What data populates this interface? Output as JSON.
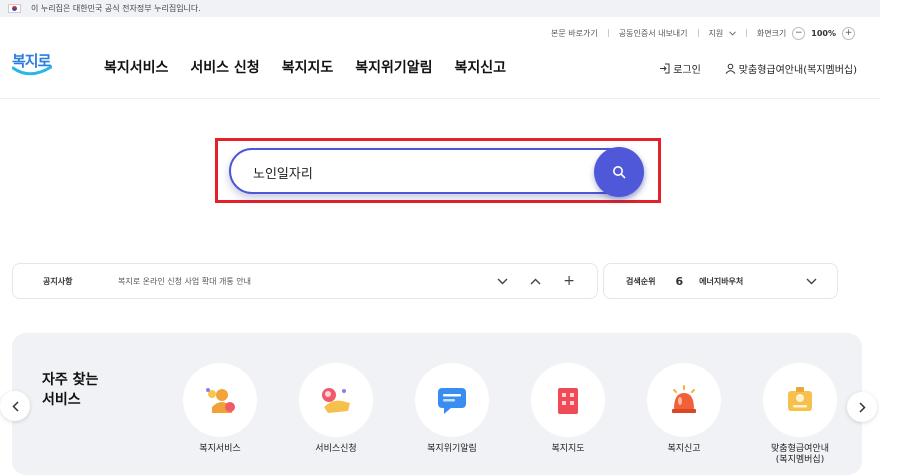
{
  "gov_banner": {
    "text": "이 누리집은 대한민국 공식 전자정부 누리집입니다."
  },
  "util_bar": {
    "skip_link": "본문 바로가기",
    "cert_export": "공동인증서 내보내기",
    "support": "지원",
    "screen_size": "화면크기",
    "zoom_minus": "−",
    "zoom_level": "100%",
    "zoom_plus": "+"
  },
  "header": {
    "logo_text": "복지로",
    "nav": [
      "복지서비스",
      "서비스 신청",
      "복지지도",
      "복지위기알림",
      "복지신고"
    ],
    "login": "로그인",
    "member": "맞춤형급여안내(복지멤버십)"
  },
  "search": {
    "value": "노인일자리"
  },
  "notice": {
    "label": "공지사항",
    "text": "복지로 온라인 신청 사업 확대 개통 안내",
    "plus": "+"
  },
  "ranking": {
    "label": "검색순위",
    "rank": "6",
    "term": "에너지바우처"
  },
  "frequent": {
    "title_line1": "자주 찾는",
    "title_line2": "서비스",
    "items": [
      {
        "label": "복지서비스"
      },
      {
        "label": "서비스신청"
      },
      {
        "label": "복지위기알림"
      },
      {
        "label": "복지지도"
      },
      {
        "label": "복지신고"
      },
      {
        "label_line1": "맞춤형급여안내",
        "label_line2": "(복지멤버십)"
      }
    ]
  },
  "colors": {
    "accent": "#4f58d8",
    "highlight": "#e3212b",
    "panel": "#f1f2f5"
  }
}
